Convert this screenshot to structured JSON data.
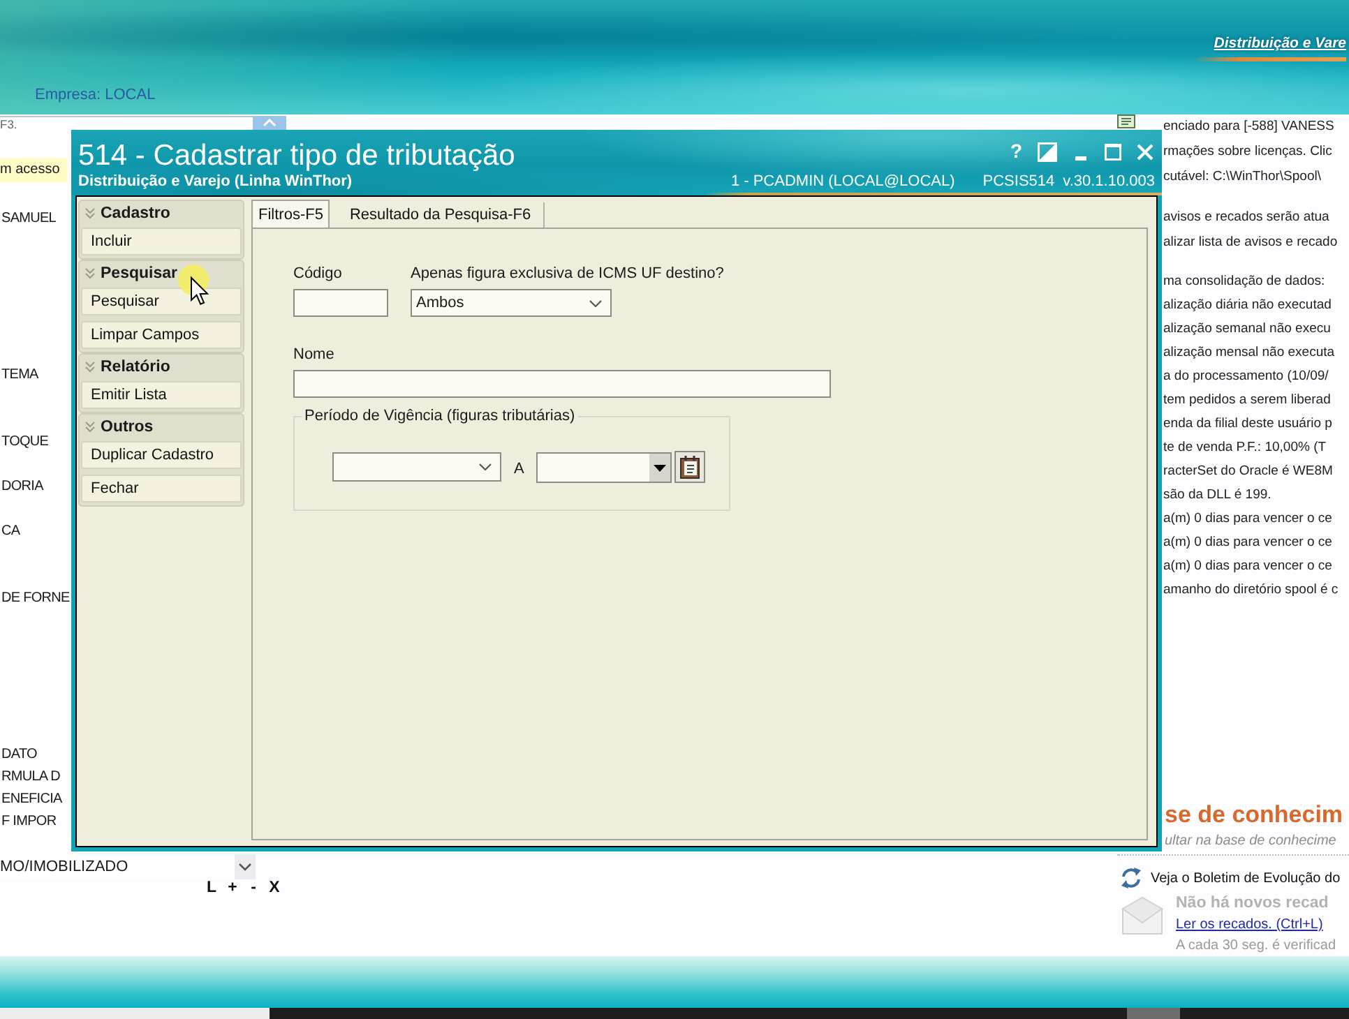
{
  "app_header": {
    "brand": "Distribuição e Vare",
    "company": "Empresa: LOCAL"
  },
  "left_panel": {
    "search_placeholder": "F3.",
    "notice": "m acesso",
    "menu_items": [
      "SAMUEL",
      "TEMA",
      "TOQUE",
      "DORIA",
      "CA",
      "DE FORNE",
      "DATO",
      "RMULA D",
      "ENEFICIA",
      "F IMPOR"
    ],
    "category_dropdown": "MO/IMOBILIZADO",
    "list_buttons": [
      "L",
      "+",
      "-",
      "X"
    ]
  },
  "info_panel": {
    "groups": [
      [
        "enciado para [-588] VANESS",
        "rmações sobre licenças. Clic",
        "cutável: C:\\WinThor\\Spool\\"
      ],
      [
        "avisos e recados serão atua",
        "alizar lista de avisos e recado"
      ],
      [
        "ma consolidação de dados:",
        "alização diária não executad",
        "alização semanal não execu",
        "alização mensal não executa",
        "a do processamento (10/09/",
        "tem pedidos a serem liberad",
        "enda da filial deste usuário p",
        "te de venda P.F.: 10,00% (T",
        "racterSet do Oracle é WE8M",
        "são da DLL é 199.",
        "a(m) 0 dias para vencer o ce",
        "a(m) 0 dias para vencer o ce",
        "a(m) 0 dias para vencer o ce",
        "amanho do diretório spool é c"
      ]
    ],
    "knowledge_title": "se de conhecim",
    "knowledge_hint": "ultar na base de conhecime",
    "bulletin": "Veja o Boletim de Evolução do",
    "messages_status": "Não há novos recad",
    "messages_link": "Ler os recados. (Ctrl+L)",
    "refresh_note": "A cada 30 seg. é verificad"
  },
  "dialog": {
    "title": "514 - Cadastrar tipo de tributação",
    "subtitle": "Distribuição e Varejo (Linha WinThor)",
    "session": "1 - PCADMIN (LOCAL@LOCAL)",
    "program": "PCSIS514",
    "version": "v.30.1.10.003",
    "help": "?",
    "action_groups": [
      {
        "title": "Cadastro",
        "expanded": true,
        "actions": [
          "Incluir"
        ]
      },
      {
        "title": "Pesquisar",
        "expanded": true,
        "actions": [
          "Pesquisar",
          "Limpar Campos"
        ]
      },
      {
        "title": "Relatório",
        "expanded": true,
        "actions": [
          "Emitir Lista"
        ]
      },
      {
        "title": "Outros",
        "expanded": true,
        "actions": [
          "Duplicar Cadastro",
          "Fechar"
        ]
      }
    ],
    "tabs": [
      {
        "label": "Filtros-F5",
        "selected": true
      },
      {
        "label": "Resultado da Pesquisa-F6",
        "selected": false
      }
    ],
    "filters": {
      "code_label": "Código",
      "icms_label": "Apenas figura exclusiva de ICMS UF destino?",
      "icms_value": "Ambos",
      "name_label": "Nome",
      "period_legend": "Período de Vigência (figuras tributárias)",
      "period_separator": "A"
    }
  }
}
